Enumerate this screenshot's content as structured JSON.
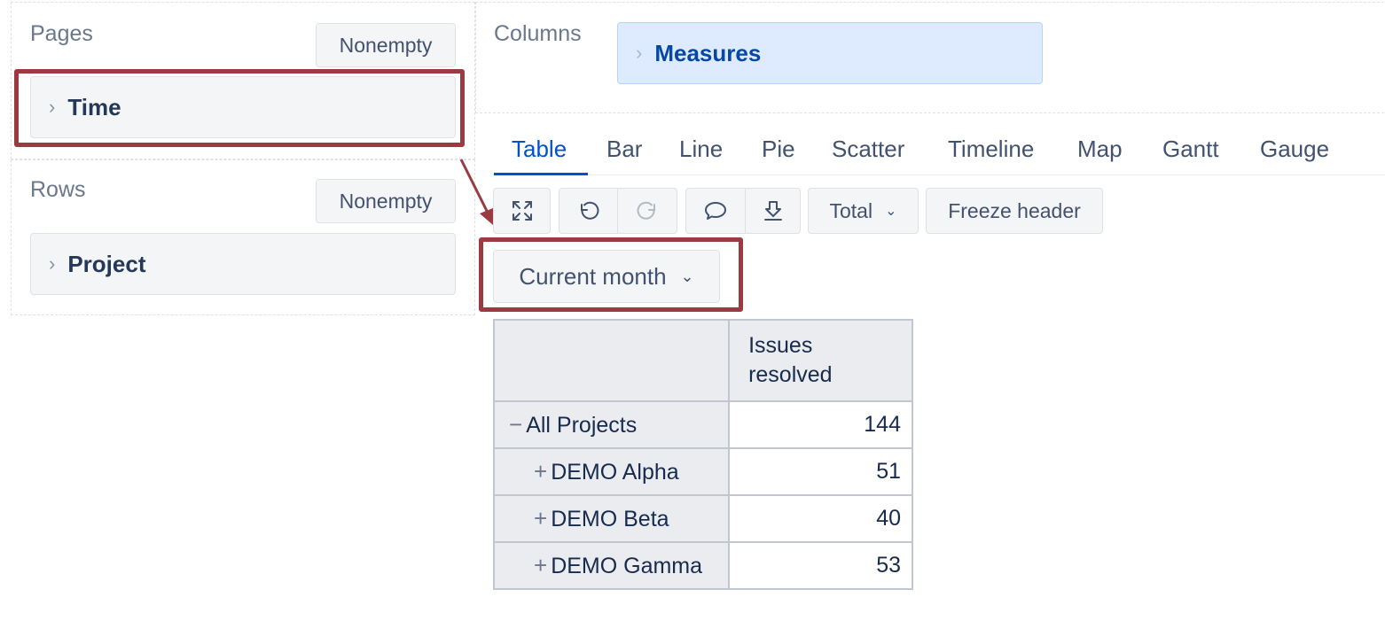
{
  "left_panel": {
    "pages": {
      "label": "Pages",
      "nonempty_label": "Nonempty",
      "dimension": "Time"
    },
    "rows": {
      "label": "Rows",
      "nonempty_label": "Nonempty",
      "dimension": "Project"
    }
  },
  "columns": {
    "label": "Columns",
    "measure": "Measures"
  },
  "chart_tabs": [
    {
      "label": "Table",
      "active": true
    },
    {
      "label": "Bar",
      "active": false
    },
    {
      "label": "Line",
      "active": false
    },
    {
      "label": "Pie",
      "active": false
    },
    {
      "label": "Scatter",
      "active": false
    },
    {
      "label": "Timeline",
      "active": false
    },
    {
      "label": "Map",
      "active": false
    },
    {
      "label": "Gantt",
      "active": false
    },
    {
      "label": "Gauge",
      "active": false
    }
  ],
  "toolbar": {
    "icons": [
      "fullscreen-icon",
      "undo-icon",
      "redo-icon",
      "comment-icon",
      "download-icon"
    ],
    "total_label": "Total",
    "freeze_label": "Freeze header"
  },
  "page_filter": {
    "selected": "Current month"
  },
  "table": {
    "column_header": "Issues resolved",
    "rows": [
      {
        "toggle": "−",
        "name": "All Projects",
        "value": "144",
        "level": 0
      },
      {
        "toggle": "+",
        "name": "DEMO Alpha",
        "value": "51",
        "level": 1
      },
      {
        "toggle": "+",
        "name": "DEMO Beta",
        "value": "40",
        "level": 1
      },
      {
        "toggle": "+",
        "name": "DEMO Gamma",
        "value": "53",
        "level": 1
      }
    ]
  },
  "colors": {
    "highlight": "#9b3a40",
    "accent": "#0052cc",
    "measures_bg": "#deebff"
  }
}
